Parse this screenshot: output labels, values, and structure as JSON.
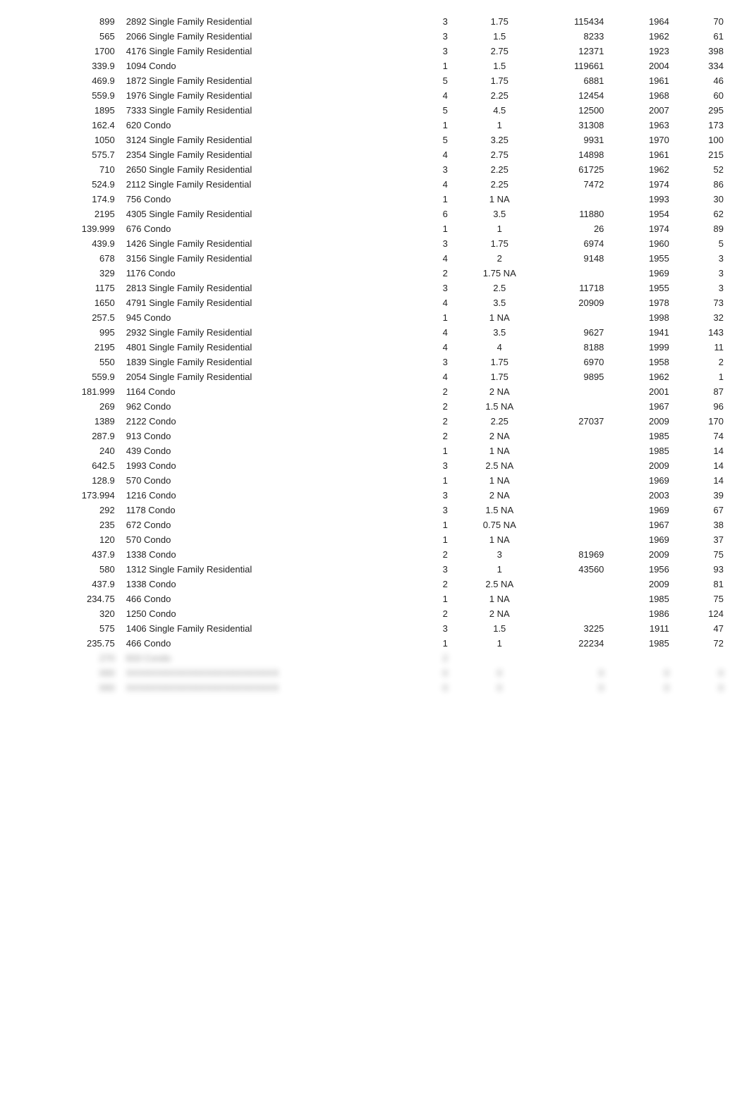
{
  "rows": [
    {
      "price": "899",
      "address": "2892 Single Family Residential",
      "beds": "3",
      "baths": "1.75",
      "sqft": "115434",
      "year": "1964",
      "days": "70"
    },
    {
      "price": "565",
      "address": "2066 Single Family Residential",
      "beds": "3",
      "baths": "1.5",
      "sqft": "8233",
      "year": "1962",
      "days": "61"
    },
    {
      "price": "1700",
      "address": "4176 Single Family Residential",
      "beds": "3",
      "baths": "2.75",
      "sqft": "12371",
      "year": "1923",
      "days": "398"
    },
    {
      "price": "339.9",
      "address": "1094 Condo",
      "beds": "1",
      "baths": "1.5",
      "sqft": "119661",
      "year": "2004",
      "days": "334"
    },
    {
      "price": "469.9",
      "address": "1872 Single Family Residential",
      "beds": "5",
      "baths": "1.75",
      "sqft": "6881",
      "year": "1961",
      "days": "46"
    },
    {
      "price": "559.9",
      "address": "1976 Single Family Residential",
      "beds": "4",
      "baths": "2.25",
      "sqft": "12454",
      "year": "1968",
      "days": "60"
    },
    {
      "price": "1895",
      "address": "7333 Single Family Residential",
      "beds": "5",
      "baths": "4.5",
      "sqft": "12500",
      "year": "2007",
      "days": "295"
    },
    {
      "price": "162.4",
      "address": "620 Condo",
      "beds": "1",
      "baths": "1",
      "sqft": "31308",
      "year": "1963",
      "days": "173"
    },
    {
      "price": "1050",
      "address": "3124 Single Family Residential",
      "beds": "5",
      "baths": "3.25",
      "sqft": "9931",
      "year": "1970",
      "days": "100"
    },
    {
      "price": "575.7",
      "address": "2354 Single Family Residential",
      "beds": "4",
      "baths": "2.75",
      "sqft": "14898",
      "year": "1961",
      "days": "215"
    },
    {
      "price": "710",
      "address": "2650 Single Family Residential",
      "beds": "3",
      "baths": "2.25",
      "sqft": "61725",
      "year": "1962",
      "days": "52"
    },
    {
      "price": "524.9",
      "address": "2112 Single Family Residential",
      "beds": "4",
      "baths": "2.25",
      "sqft": "7472",
      "year": "1974",
      "days": "86"
    },
    {
      "price": "174.9",
      "address": "756 Condo",
      "beds": "1",
      "baths": "1 NA",
      "sqft": "",
      "year": "1993",
      "days": "30"
    },
    {
      "price": "2195",
      "address": "4305 Single Family Residential",
      "beds": "6",
      "baths": "3.5",
      "sqft": "11880",
      "year": "1954",
      "days": "62"
    },
    {
      "price": "139.999",
      "address": "676 Condo",
      "beds": "1",
      "baths": "1",
      "sqft": "26",
      "year": "1974",
      "days": "89"
    },
    {
      "price": "439.9",
      "address": "1426 Single Family Residential",
      "beds": "3",
      "baths": "1.75",
      "sqft": "6974",
      "year": "1960",
      "days": "5"
    },
    {
      "price": "678",
      "address": "3156 Single Family Residential",
      "beds": "4",
      "baths": "2",
      "sqft": "9148",
      "year": "1955",
      "days": "3"
    },
    {
      "price": "329",
      "address": "1176 Condo",
      "beds": "2",
      "baths": "1.75 NA",
      "sqft": "",
      "year": "1969",
      "days": "3"
    },
    {
      "price": "1175",
      "address": "2813 Single Family Residential",
      "beds": "3",
      "baths": "2.5",
      "sqft": "11718",
      "year": "1955",
      "days": "3"
    },
    {
      "price": "1650",
      "address": "4791 Single Family Residential",
      "beds": "4",
      "baths": "3.5",
      "sqft": "20909",
      "year": "1978",
      "days": "73"
    },
    {
      "price": "257.5",
      "address": "945 Condo",
      "beds": "1",
      "baths": "1 NA",
      "sqft": "",
      "year": "1998",
      "days": "32"
    },
    {
      "price": "995",
      "address": "2932 Single Family Residential",
      "beds": "4",
      "baths": "3.5",
      "sqft": "9627",
      "year": "1941",
      "days": "143"
    },
    {
      "price": "2195",
      "address": "4801 Single Family Residential",
      "beds": "4",
      "baths": "4",
      "sqft": "8188",
      "year": "1999",
      "days": "11"
    },
    {
      "price": "550",
      "address": "1839 Single Family Residential",
      "beds": "3",
      "baths": "1.75",
      "sqft": "6970",
      "year": "1958",
      "days": "2"
    },
    {
      "price": "559.9",
      "address": "2054 Single Family Residential",
      "beds": "4",
      "baths": "1.75",
      "sqft": "9895",
      "year": "1962",
      "days": "1"
    },
    {
      "price": "181.999",
      "address": "1164 Condo",
      "beds": "2",
      "baths": "2 NA",
      "sqft": "",
      "year": "2001",
      "days": "87"
    },
    {
      "price": "269",
      "address": "962 Condo",
      "beds": "2",
      "baths": "1.5 NA",
      "sqft": "",
      "year": "1967",
      "days": "96"
    },
    {
      "price": "1389",
      "address": "2122 Condo",
      "beds": "2",
      "baths": "2.25",
      "sqft": "27037",
      "year": "2009",
      "days": "170"
    },
    {
      "price": "287.9",
      "address": "913 Condo",
      "beds": "2",
      "baths": "2 NA",
      "sqft": "",
      "year": "1985",
      "days": "74"
    },
    {
      "price": "240",
      "address": "439 Condo",
      "beds": "1",
      "baths": "1 NA",
      "sqft": "",
      "year": "1985",
      "days": "14"
    },
    {
      "price": "642.5",
      "address": "1993 Condo",
      "beds": "3",
      "baths": "2.5 NA",
      "sqft": "",
      "year": "2009",
      "days": "14"
    },
    {
      "price": "128.9",
      "address": "570 Condo",
      "beds": "1",
      "baths": "1 NA",
      "sqft": "",
      "year": "1969",
      "days": "14"
    },
    {
      "price": "173.994",
      "address": "1216 Condo",
      "beds": "3",
      "baths": "2 NA",
      "sqft": "",
      "year": "2003",
      "days": "39"
    },
    {
      "price": "292",
      "address": "1178 Condo",
      "beds": "3",
      "baths": "1.5 NA",
      "sqft": "",
      "year": "1969",
      "days": "67"
    },
    {
      "price": "235",
      "address": "672 Condo",
      "beds": "1",
      "baths": "0.75 NA",
      "sqft": "",
      "year": "1967",
      "days": "38"
    },
    {
      "price": "120",
      "address": "570 Condo",
      "beds": "1",
      "baths": "1 NA",
      "sqft": "",
      "year": "1969",
      "days": "37"
    },
    {
      "price": "437.9",
      "address": "1338 Condo",
      "beds": "2",
      "baths": "3",
      "sqft": "81969",
      "year": "2009",
      "days": "75"
    },
    {
      "price": "580",
      "address": "1312 Single Family Residential",
      "beds": "3",
      "baths": "1",
      "sqft": "43560",
      "year": "1956",
      "days": "93"
    },
    {
      "price": "437.9",
      "address": "1338 Condo",
      "beds": "2",
      "baths": "2.5 NA",
      "sqft": "",
      "year": "2009",
      "days": "81"
    },
    {
      "price": "234.75",
      "address": "466 Condo",
      "beds": "1",
      "baths": "1 NA",
      "sqft": "",
      "year": "1985",
      "days": "75"
    },
    {
      "price": "320",
      "address": "1250 Condo",
      "beds": "2",
      "baths": "2 NA",
      "sqft": "",
      "year": "1986",
      "days": "124"
    },
    {
      "price": "575",
      "address": "1406 Single Family Residential",
      "beds": "3",
      "baths": "1.5",
      "sqft": "3225",
      "year": "1911",
      "days": "47"
    },
    {
      "price": "235.75",
      "address": "466 Condo",
      "beds": "1",
      "baths": "1",
      "sqft": "22234",
      "year": "1985",
      "days": "72"
    },
    {
      "price": "270",
      "address": "833 Condo",
      "beds": "2",
      "baths": "",
      "sqft": "",
      "year": "",
      "days": ""
    }
  ]
}
